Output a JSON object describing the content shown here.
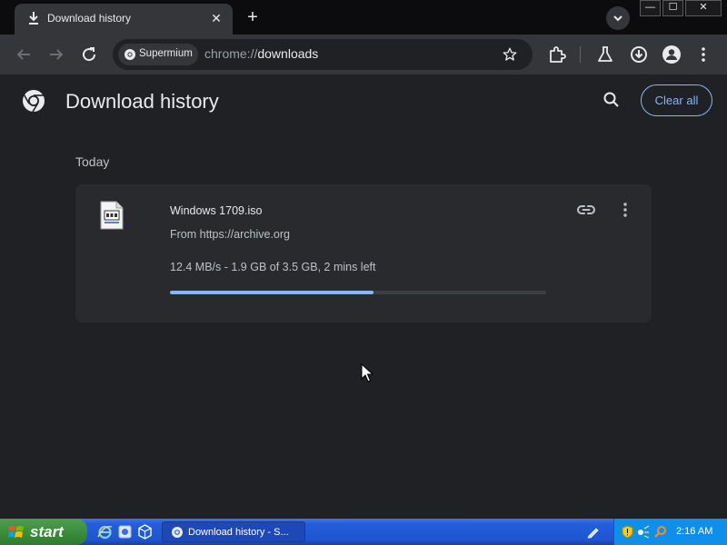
{
  "browser": {
    "tab": {
      "title": "Download history",
      "close_glyph": "✕"
    },
    "new_tab_glyph": "+",
    "window_controls": {
      "minimize": "—",
      "maximize": "☐",
      "close": "✕"
    },
    "omnibox": {
      "chip_label": "Supermium",
      "url_scheme": "chrome://",
      "url_host": "downloads"
    }
  },
  "page": {
    "title": "Download history",
    "clear_all_label": "Clear all",
    "section_date": "Today",
    "downloads": [
      {
        "file_name": "Windows 1709.iso",
        "source": "From https://archive.org",
        "status": "12.4 MB/s - 1.9 GB of 3.5 GB, 2 mins left",
        "progress": 0.54
      }
    ]
  },
  "taskbar": {
    "start_label": "start",
    "task_label": "Download history - S...",
    "clock": "2:16 AM"
  },
  "colors": {
    "accent": "#8ab4f8",
    "background": "#202124",
    "card": "#292a2d",
    "taskbar": "#245edb",
    "start": "#3c8d3c"
  }
}
